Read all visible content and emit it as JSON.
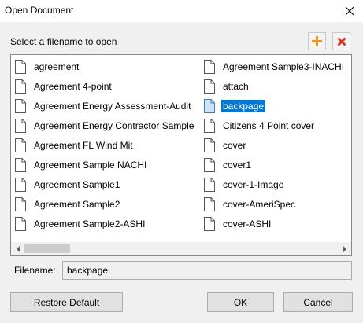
{
  "window": {
    "title": "Open Document"
  },
  "instruction": "Select a filename to open",
  "toolbar": {
    "add_icon": "plus-icon",
    "delete_icon": "delete-x-icon",
    "add_color": "#f7941d",
    "delete_color": "#d9332b"
  },
  "files": {
    "column1": [
      {
        "name": "agreement",
        "selected": false
      },
      {
        "name": "Agreement 4-point",
        "selected": false
      },
      {
        "name": "Agreement Energy Assessment-Audit",
        "selected": false
      },
      {
        "name": "Agreement Energy Contractor Sample",
        "selected": false
      },
      {
        "name": "Agreement FL Wind Mit",
        "selected": false
      },
      {
        "name": "Agreement Sample NACHI",
        "selected": false
      },
      {
        "name": "Agreement Sample1",
        "selected": false
      },
      {
        "name": "Agreement Sample2",
        "selected": false
      },
      {
        "name": "Agreement Sample2-ASHI",
        "selected": false
      }
    ],
    "column2": [
      {
        "name": "Agreement Sample3-INACHI",
        "selected": false
      },
      {
        "name": "attach",
        "selected": false
      },
      {
        "name": "backpage",
        "selected": true
      },
      {
        "name": "Citizens 4 Point cover",
        "selected": false
      },
      {
        "name": "cover",
        "selected": false
      },
      {
        "name": "cover1",
        "selected": false
      },
      {
        "name": "cover-1-Image",
        "selected": false
      },
      {
        "name": "cover-AmeriSpec",
        "selected": false
      },
      {
        "name": "cover-ASHI",
        "selected": false
      }
    ]
  },
  "filename": {
    "label": "Filename:",
    "value": "backpage"
  },
  "buttons": {
    "restore": "Restore Default",
    "ok": "OK",
    "cancel": "Cancel"
  },
  "colors": {
    "selection": "#0078d7"
  }
}
